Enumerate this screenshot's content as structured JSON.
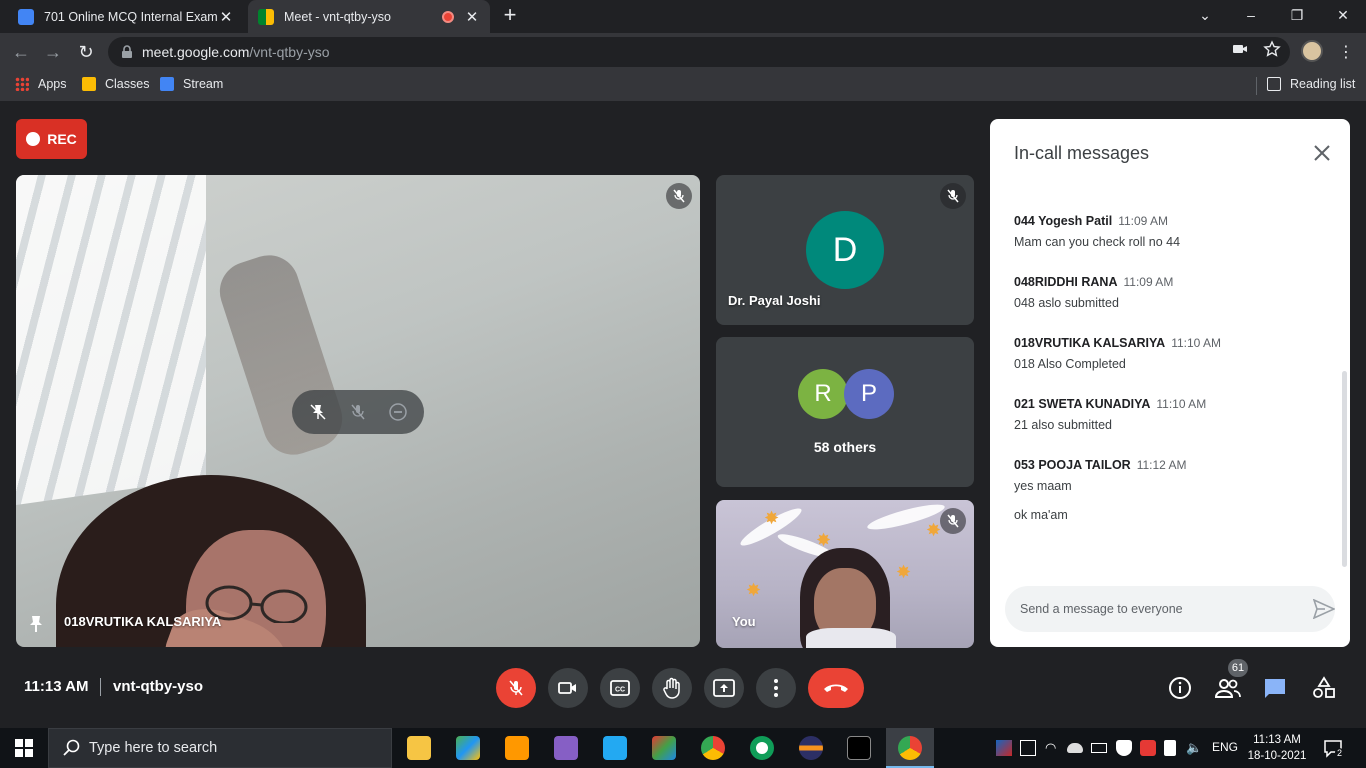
{
  "browser": {
    "tabs": [
      {
        "title": "701 Online MCQ Internal Exam",
        "close": "✕"
      },
      {
        "title": "Meet - vnt-qtby-yso",
        "close": "✕"
      }
    ],
    "new_tab": "+",
    "url_host": "meet.google.com",
    "url_path": "/vnt-qtby-yso",
    "bookmarks": [
      "Apps",
      "Classes",
      "Stream"
    ],
    "reading_list": "Reading list"
  },
  "meet": {
    "rec_label": "REC",
    "main_participant": "018VRUTIKA KALSARIYA",
    "tiles": {
      "host_name": "Dr. Payal Joshi",
      "host_initial": "D",
      "others_initials": [
        "R",
        "P"
      ],
      "others_label": "58 others",
      "you_label": "You"
    },
    "colors": {
      "host_avatar": "#00897b",
      "others_r": "#7cb342",
      "others_p": "#5c6bc0",
      "rec": "#d93025",
      "end_call": "#ea4335"
    },
    "chat": {
      "title": "In-call messages",
      "messages": [
        {
          "sender": "044 Yogesh Patil",
          "time": "11:09 AM",
          "text": "Mam can you check roll no 44"
        },
        {
          "sender": "048RIDDHI RANA",
          "time": "11:09 AM",
          "text": "048 aslo submitted"
        },
        {
          "sender": "018VRUTIKA KALSARIYA",
          "time": "11:10 AM",
          "text": "018 Also Completed"
        },
        {
          "sender": "021 SWETA KUNADIYA",
          "time": "11:10 AM",
          "text": "21 also submitted"
        },
        {
          "sender": "053 POOJA TAILOR",
          "time": "11:12 AM",
          "text": "yes maam",
          "text2": "ok ma'am"
        }
      ],
      "input_placeholder": "Send a message to everyone"
    },
    "bottom": {
      "time": "11:13 AM",
      "meeting_code": "vnt-qtby-yso",
      "participants_count": "61"
    }
  },
  "taskbar": {
    "search_placeholder": "Type here to search",
    "language": "ENG",
    "time": "11:13 AM",
    "date": "18-10-2021",
    "notifications": "2"
  }
}
